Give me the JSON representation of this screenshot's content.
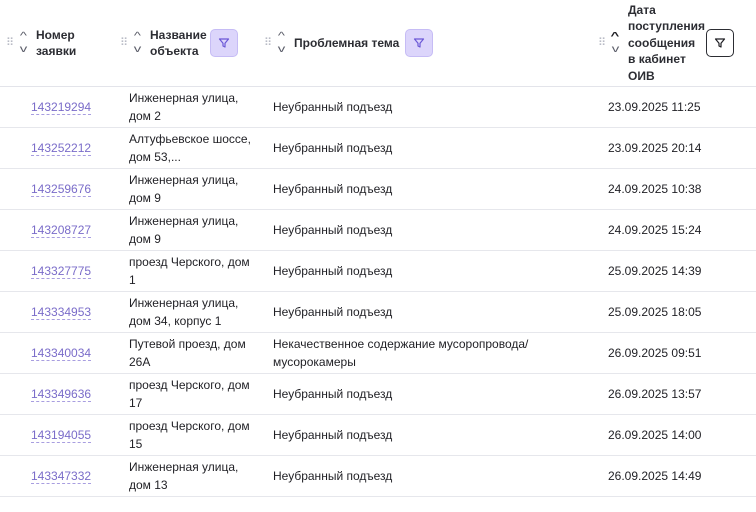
{
  "columns": {
    "number": "Номер заявки",
    "object": "Название объекта",
    "topic": "Проблемная тема",
    "date": "Дата поступления сообщения в кабинет ОИВ"
  },
  "rows": [
    {
      "id": "143219294",
      "object": "Инженерная улица, дом 2",
      "topic": "Неубранный подъезд",
      "date": "23.09.2025 11:25"
    },
    {
      "id": "143252212",
      "object": "Алтуфьевское шоссе, дом 53,...",
      "topic": "Неубранный подъезд",
      "date": "23.09.2025 20:14"
    },
    {
      "id": "143259676",
      "object": "Инженерная улица, дом 9",
      "topic": "Неубранный подъезд",
      "date": "24.09.2025 10:38"
    },
    {
      "id": "143208727",
      "object": "Инженерная улица, дом 9",
      "topic": "Неубранный подъезд",
      "date": "24.09.2025 15:24"
    },
    {
      "id": "143327775",
      "object": "проезд Черского, дом 1",
      "topic": "Неубранный подъезд",
      "date": "25.09.2025 14:39"
    },
    {
      "id": "143334953",
      "object": "Инженерная улица, дом 34, корпус 1",
      "topic": "Неубранный подъезд",
      "date": "25.09.2025 18:05"
    },
    {
      "id": "143340034",
      "object": "Путевой проезд, дом 26А",
      "topic": "Некачественное содержание мусоропровода/ мусорокамеры",
      "date": "26.09.2025 09:51"
    },
    {
      "id": "143349636",
      "object": "проезд Черского, дом 17",
      "topic": "Неубранный подъезд",
      "date": "26.09.2025 13:57"
    },
    {
      "id": "143194055",
      "object": "проезд Черского, дом 15",
      "topic": "Неубранный подъезд",
      "date": "26.09.2025 14:00"
    },
    {
      "id": "143347332",
      "object": "Инженерная улица, дом 13",
      "topic": "Неубранный подъезд",
      "date": "26.09.2025 14:49"
    }
  ],
  "icons": {
    "drag": "drag-handle-icon",
    "sort_asc": "chevron-up-icon",
    "sort_desc": "chevron-down-icon",
    "filter": "filter-icon"
  },
  "colors": {
    "link": "#7a6cc9",
    "filter_active_bg": "#dcd5fb",
    "border": "#e6e7ec"
  }
}
